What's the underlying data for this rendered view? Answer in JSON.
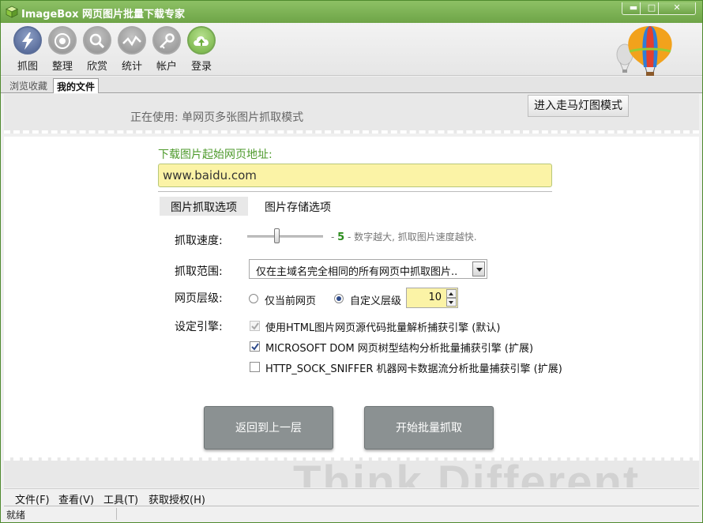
{
  "window": {
    "title": "ImageBox 网页图片批量下载专家",
    "min_symbol": "▬",
    "max_symbol": "□",
    "close_symbol": "✕"
  },
  "toolbar": {
    "items": [
      {
        "label": "抓图",
        "icon": "lightning-icon",
        "active": true
      },
      {
        "label": "整理",
        "icon": "eye-icon"
      },
      {
        "label": "欣赏",
        "icon": "magnifier-icon"
      },
      {
        "label": "统计",
        "icon": "chart-line-icon"
      },
      {
        "label": "帐户",
        "icon": "key-icon"
      },
      {
        "label": "登录",
        "icon": "cloud-upload-icon",
        "accent": "#6fae3f"
      }
    ]
  },
  "tabs": {
    "items": [
      "浏览收藏",
      "我的文件"
    ],
    "active": "我的文件"
  },
  "mode": {
    "current": "正在使用: 单网页多张图片抓取模式",
    "marquee_button": "进入走马灯图模式"
  },
  "url": {
    "label": "下载图片起始网页地址:",
    "value": "www.baidu.com"
  },
  "options_tabs": [
    "图片抓取选项",
    "图片存储选项"
  ],
  "speed": {
    "label": "抓取速度:",
    "value": "5",
    "prefix": "- ",
    "hint": " - 数字越大, 抓取图片速度越快."
  },
  "scope": {
    "label": "抓取范围:",
    "selected": "仅在主域名完全相同的所有网页中抓取图片.."
  },
  "level": {
    "label": "网页层级:",
    "option_current": "仅当前网页",
    "option_custom": "自定义层级",
    "selected": "自定义层级",
    "custom_value": "10"
  },
  "engine": {
    "label": "设定引擎:",
    "options": [
      {
        "label": "使用HTML图片网页源代码批量解析捕获引擎 (默认)",
        "checked": true,
        "disabled": true
      },
      {
        "label": "MICROSOFT DOM 网页树型结构分析批量捕获引擎 (扩展)",
        "checked": true,
        "disabled": false
      },
      {
        "label": "HTTP_SOCK_SNIFFER 机器网卡数据流分析批量捕获引擎 (扩展)",
        "checked": false,
        "disabled": false
      }
    ]
  },
  "actions": {
    "back": "返回到上一层",
    "start": "开始批量抓取"
  },
  "slogan": "Think Different",
  "menu": [
    "文件(F)",
    "查看(V)",
    "工具(T)",
    "获取授权(H)"
  ],
  "status": "就绪",
  "colors": {
    "title_bar": "#7bb252",
    "url_bg": "#fbf3a6",
    "label_green": "#4e9a2c",
    "button_gray": "#8b9192"
  }
}
